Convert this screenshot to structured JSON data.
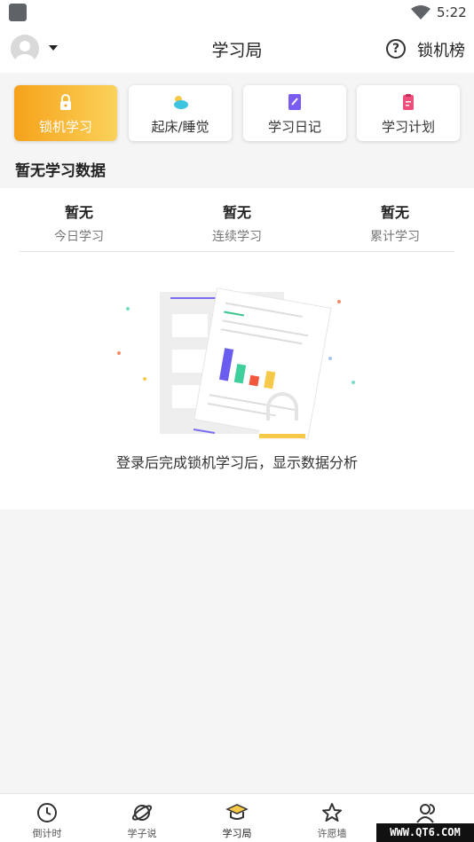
{
  "status_bar": {
    "time": "5:22"
  },
  "header": {
    "title": "学习局",
    "rank_label": "锁机榜"
  },
  "tabs": [
    {
      "label": "锁机学习",
      "icon": "lock-icon",
      "active": true
    },
    {
      "label": "起床/睡觉",
      "icon": "weather-icon",
      "active": false
    },
    {
      "label": "学习日记",
      "icon": "diary-icon",
      "active": false
    },
    {
      "label": "学习计划",
      "icon": "plan-icon",
      "active": false
    }
  ],
  "section_title": "暂无学习数据",
  "stats": [
    {
      "value": "暂无",
      "label": "今日学习"
    },
    {
      "value": "暂无",
      "label": "连续学习"
    },
    {
      "value": "暂无",
      "label": "累计学习"
    }
  ],
  "empty_state": {
    "text": "登录后完成锁机学习后，显示数据分析"
  },
  "bottom_nav": [
    {
      "label": "倒计时",
      "icon": "clock-icon",
      "active": false
    },
    {
      "label": "学子说",
      "icon": "planet-icon",
      "active": false
    },
    {
      "label": "学习局",
      "icon": "graduation-cap-icon",
      "active": true
    },
    {
      "label": "许愿墙",
      "icon": "star-icon",
      "active": false
    },
    {
      "label": "",
      "icon": "users-icon",
      "active": false
    }
  ],
  "watermark": "WWW.QT6.COM",
  "colors": {
    "accent_start": "#f6a21a",
    "accent_end": "#fbd25a"
  }
}
